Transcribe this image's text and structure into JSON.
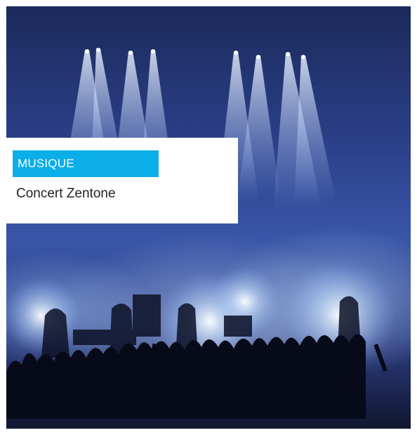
{
  "card": {
    "image_alt": "concert-stage-photo",
    "category": "MUSIQUE",
    "title": "Concert Zentone"
  },
  "colors": {
    "category_bg": "#0aaee8",
    "category_text": "#ffffff",
    "title_text": "#222222",
    "box_bg": "#ffffff"
  }
}
